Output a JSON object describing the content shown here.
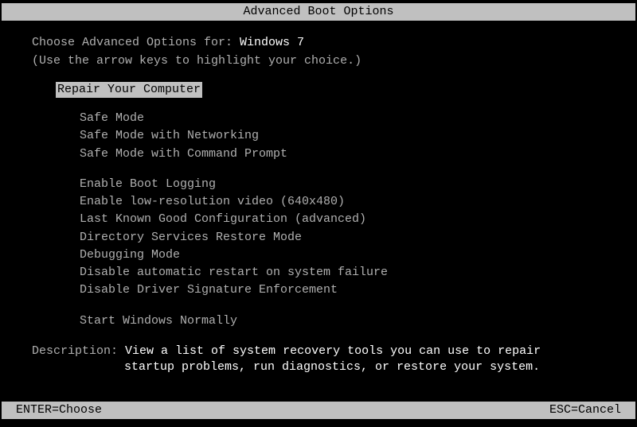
{
  "title": "Advanced Boot Options",
  "prompt_label": "Choose Advanced Options for: ",
  "os_name": "Windows 7",
  "instruction": "(Use the arrow keys to highlight your choice.)",
  "selected_item": "Repair Your Computer",
  "menu_groups": [
    [
      "Safe Mode",
      "Safe Mode with Networking",
      "Safe Mode with Command Prompt"
    ],
    [
      "Enable Boot Logging",
      "Enable low-resolution video (640x480)",
      "Last Known Good Configuration (advanced)",
      "Directory Services Restore Mode",
      "Debugging Mode",
      "Disable automatic restart on system failure",
      "Disable Driver Signature Enforcement"
    ],
    [
      "Start Windows Normally"
    ]
  ],
  "description_label": "Description: ",
  "description_line1": "View a list of system recovery tools you can use to repair",
  "description_line2": "startup problems, run diagnostics, or restore your system.",
  "footer_left": "ENTER=Choose",
  "footer_right": "ESC=Cancel"
}
